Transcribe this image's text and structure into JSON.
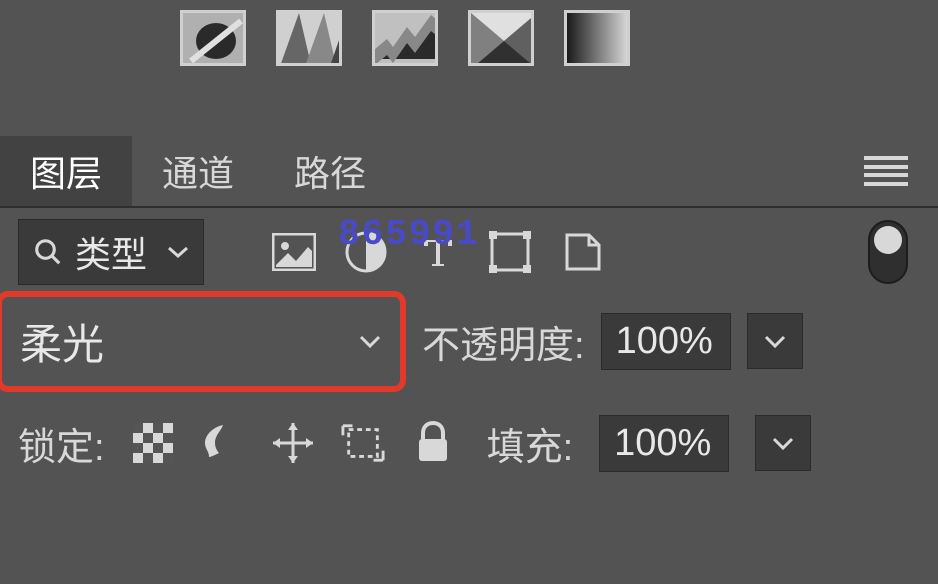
{
  "watermark": "865991",
  "tabs": {
    "layers": "图层",
    "channels": "通道",
    "paths": "路径"
  },
  "filter": {
    "kind_label": "类型"
  },
  "blend": {
    "mode": "柔光",
    "opacity_label": "不透明度:",
    "opacity_value": "100%"
  },
  "lock": {
    "label": "锁定:",
    "fill_label": "填充:",
    "fill_value": "100%"
  }
}
